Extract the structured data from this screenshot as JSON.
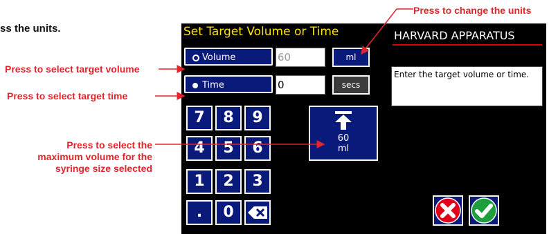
{
  "manual": {
    "intro_fragment": "ss the units.",
    "callouts": {
      "units": "Press to change the units",
      "volume": "Press to select target volume",
      "time": "Press to select target time",
      "max_line1": "Press to select the",
      "max_line2": "maximum volume for the",
      "max_line3": "syringe size selected"
    },
    "accent_color": "#e3242b"
  },
  "screen": {
    "title": "Set Target Volume or Time",
    "brand": "HARVARD APPARATUS",
    "volume": {
      "label": "Volume",
      "value": "60",
      "unit": "ml"
    },
    "time": {
      "label": "Time",
      "value": "0",
      "unit": "secs"
    },
    "message": "Enter the target volume or time.",
    "keypad": [
      "7",
      "8",
      "9",
      "4",
      "5",
      "6",
      "1",
      "2",
      "3",
      ".",
      "0"
    ],
    "max_button": {
      "value": "60",
      "unit": "ml",
      "icon": "arrow-to-top-icon"
    },
    "actions": {
      "cancel_icon": "cancel-x-icon",
      "confirm_icon": "confirm-check-icon"
    },
    "colors": {
      "button_blue": "#0a1a7a",
      "title_yellow": "#ffe100",
      "brand_underline": "#e00000",
      "cancel_red": "#e0001b",
      "confirm_green": "#1e9e3c"
    }
  }
}
